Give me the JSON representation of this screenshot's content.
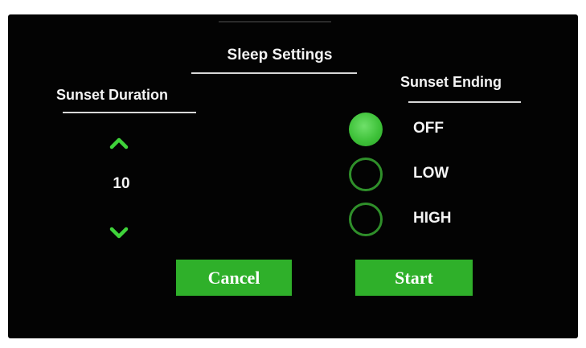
{
  "screen": {
    "title": "Sleep Settings",
    "sunset_duration": {
      "label": "Sunset Duration",
      "value": "10",
      "increment_icon": "chevron-up-icon",
      "decrement_icon": "chevron-down-icon"
    },
    "sunset_ending": {
      "label": "Sunset Ending",
      "options": [
        {
          "label": "OFF",
          "selected": true
        },
        {
          "label": "LOW",
          "selected": false
        },
        {
          "label": "HIGH",
          "selected": false
        }
      ]
    },
    "buttons": {
      "cancel_label": "Cancel",
      "start_label": "Start"
    }
  },
  "colors": {
    "background": "#030303",
    "accent_green": "#2fb02a",
    "text": "#f4f4f4"
  }
}
